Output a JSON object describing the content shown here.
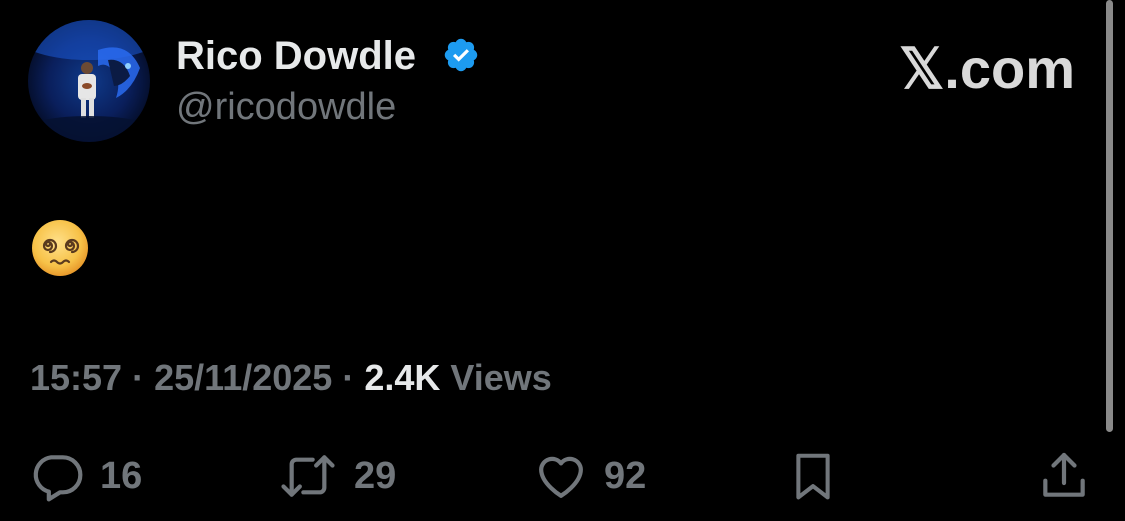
{
  "tweet": {
    "author": {
      "display_name": "Rico Dowdle",
      "handle": "@ricodowdle",
      "verified": true,
      "avatar_icon": "avatar-panthers-photo"
    },
    "brand": "𝕏.com",
    "content": {
      "emoji": "face-with-spiral-eyes"
    },
    "meta": {
      "time": "15:57",
      "separator": "·",
      "date": "25/11/2025",
      "views_count": "2.4K",
      "views_label": "Views"
    },
    "actions": {
      "replies": "16",
      "reposts": "29",
      "likes": "92"
    }
  },
  "colors": {
    "background": "#000000",
    "primary_text": "#e7e9ea",
    "secondary_text": "#71767b",
    "verified_blue": "#1d9bf0",
    "emoji_yellow": "#f7c248"
  }
}
